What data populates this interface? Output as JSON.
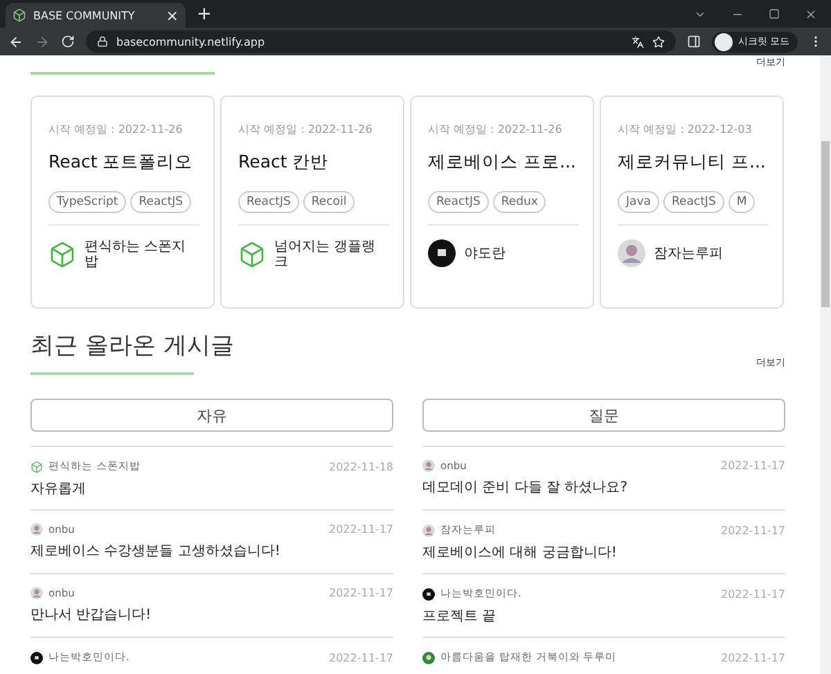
{
  "browser": {
    "tab_title": "BASE COMMUNITY",
    "tab_close": "×",
    "new_tab": "+",
    "url": "basecommunity.netlify.app",
    "profile": "시크릿 모드"
  },
  "projects": {
    "more": "더보기",
    "cards": [
      {
        "start_date": "시작 예정일 : 2022-11-26",
        "title": "React 포트폴리오",
        "tags": [
          "TypeScript",
          "ReactJS"
        ],
        "author": "편식하는 스폰지밥",
        "kind": "cube"
      },
      {
        "start_date": "시작 예정일 : 2022-11-26",
        "title": "React 칸반",
        "tags": [
          "ReactJS",
          "Recoil"
        ],
        "author": "넘어지는 갱플랭크",
        "kind": "cube"
      },
      {
        "start_date": "시작 예정일 : 2022-11-26",
        "title": "제로베이스 프로...",
        "tags": [
          "ReactJS",
          "Redux"
        ],
        "author": "야도란",
        "kind": "dark"
      },
      {
        "start_date": "시작 예정일 : 2022-12-03",
        "title": "제로커뮤니티 프...",
        "tags": [
          "Java",
          "ReactJS",
          "M"
        ],
        "author": "잠자는루피",
        "kind": "photo"
      }
    ]
  },
  "recent_posts": {
    "title": "최근 올라온 게시글",
    "more": "더보기",
    "boards": [
      {
        "name": "자유",
        "posts": [
          {
            "author": "편식하는 스폰지밥",
            "kind": "cube",
            "date": "2022-11-18",
            "title": "자유롭게"
          },
          {
            "author": "onbu",
            "kind": "photo",
            "date": "2022-11-17",
            "title": "제로베이스 수강생분들 고생하셨습니다!"
          },
          {
            "author": "onbu",
            "kind": "photo",
            "date": "2022-11-17",
            "title": "만나서 반갑습니다!"
          },
          {
            "author": "나는박호민이다.",
            "kind": "dark",
            "date": "2022-11-17"
          }
        ]
      },
      {
        "name": "질문",
        "posts": [
          {
            "author": "onbu",
            "kind": "photo",
            "date": "2022-11-17",
            "title": "데모데이 준비 다들 잘 하셨나요?"
          },
          {
            "author": "잠자는루피",
            "kind": "photo",
            "date": "2022-11-17",
            "title": "제로베이스에 대해 궁금합니다!"
          },
          {
            "author": "나는박호민이다.",
            "kind": "dark",
            "date": "2022-11-17",
            "title": "프로젝트 끝"
          },
          {
            "author": "아름다움을 탑재한 거북이와 두루미",
            "kind": "green",
            "date": "2022-11-17"
          }
        ]
      }
    ]
  }
}
